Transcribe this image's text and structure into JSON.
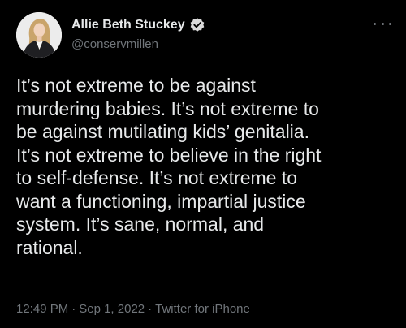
{
  "author": {
    "display_name": "Allie Beth Stuckey",
    "handle": "@conservmillen",
    "verified": true,
    "avatar_icon": "profile-photo",
    "verified_icon": "verified-badge-icon"
  },
  "menu": {
    "icon": "more-options-icon"
  },
  "tweet": {
    "lines": [
      "It’s not extreme to be against",
      "murdering babies. It’s not extreme to",
      "be against mutilating kids’ genitalia.",
      "It’s not extreme to believe in the right",
      "to self-defense. It’s not extreme to",
      "want a functioning, impartial justice",
      "system. It’s sane, normal, and",
      "rational."
    ],
    "time": "12:49 PM",
    "date": "Sep 1, 2022",
    "separator": "·",
    "source": "Twitter for iPhone"
  },
  "colors": {
    "background": "#000000",
    "text_primary": "#e7e9ea",
    "text_secondary": "#71767b",
    "verified_badge": "#d9d9d9"
  }
}
